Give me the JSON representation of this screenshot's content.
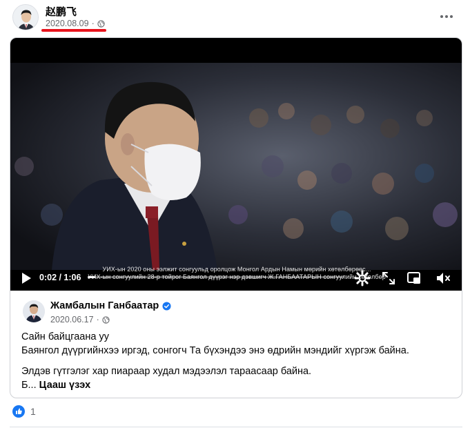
{
  "post": {
    "author": "赵鹏飞",
    "date": "2020.08.09",
    "separator": "·",
    "privacy_icon": "globe-icon",
    "more_icon": "more-horizontal-icon"
  },
  "video": {
    "current_time": "0:02",
    "duration": "1:06",
    "time_display": "0:02 / 1:06",
    "progress_fraction": 0.03,
    "caption_line1": "УИХ-ын 2020 оны ээлжит сонгуульд оролцож Монгол Ардын Намын мөрийн хөтөлбөрөөс...",
    "caption_line2": "УИХ-ын сонгуулийн 28-р тойрог Баянгол дүүрэг нэр дэвшигч Ж.ГАНБААТАРЫН сонгуулийн хөтөлбөр",
    "icons": [
      "play-icon",
      "settings-icon",
      "fullscreen-icon",
      "picture-in-picture-icon",
      "mute-icon"
    ]
  },
  "shared": {
    "author": "Жамбалын Ганбаатар",
    "date": "2020.06.17",
    "separator": "·",
    "verified_icon": "verified-badge-icon",
    "privacy_icon": "globe-icon"
  },
  "body": {
    "line1": "Сайн байцгаана уу",
    "line2": "Баянгол дүүргийнхээ иргэд, сонгогч Та бүхэндээ энэ өдрийн мэндийг хүргэж байна.",
    "line3": "Элдэв гүтгэлэг хар пиараар худал мэдээлэл тараасаар байна.",
    "line4_prefix": "Б... ",
    "see_more": "Цааш үзэх"
  },
  "reactions": {
    "count": "1",
    "icon": "like-icon"
  },
  "colors": {
    "accent": "#1877f2",
    "highlight": "#e8141d",
    "secondary_text": "#65676b"
  }
}
